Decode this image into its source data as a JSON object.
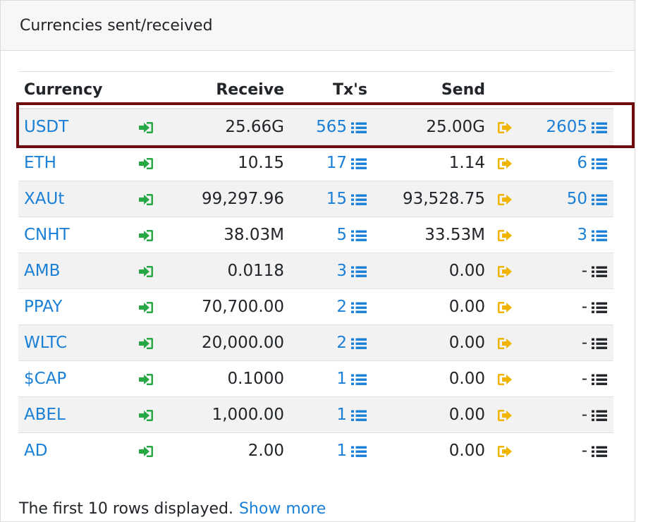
{
  "panel": {
    "title": "Currencies sent/received"
  },
  "table": {
    "headers": {
      "currency": "Currency",
      "receive": "Receive",
      "txs": "Tx's",
      "send": "Send"
    },
    "rows": [
      {
        "currency": "USDT",
        "receive": "25.66G",
        "receive_txs": "565",
        "send": "25.00G",
        "send_txs": "2605"
      },
      {
        "currency": "ETH",
        "receive": "10.15",
        "receive_txs": "17",
        "send": "1.14",
        "send_txs": "6"
      },
      {
        "currency": "XAUt",
        "receive": "99,297.96",
        "receive_txs": "15",
        "send": "93,528.75",
        "send_txs": "50"
      },
      {
        "currency": "CNHT",
        "receive": "38.03M",
        "receive_txs": "5",
        "send": "33.53M",
        "send_txs": "3"
      },
      {
        "currency": "AMB",
        "receive": "0.0118",
        "receive_txs": "3",
        "send": "0.00",
        "send_txs": "-"
      },
      {
        "currency": "PPAY",
        "receive": "70,700.00",
        "receive_txs": "2",
        "send": "0.00",
        "send_txs": "-"
      },
      {
        "currency": "WLTC",
        "receive": "20,000.00",
        "receive_txs": "2",
        "send": "0.00",
        "send_txs": "-"
      },
      {
        "currency": "$CAP",
        "receive": "0.1000",
        "receive_txs": "1",
        "send": "0.00",
        "send_txs": "-"
      },
      {
        "currency": "ABEL",
        "receive": "1,000.00",
        "receive_txs": "1",
        "send": "0.00",
        "send_txs": "-"
      },
      {
        "currency": "AD",
        "receive": "2.00",
        "receive_txs": "1",
        "send": "0.00",
        "send_txs": "-"
      }
    ]
  },
  "footer": {
    "text": "The first 10 rows displayed.",
    "link": "Show more"
  },
  "colors": {
    "link": "#1a7fd6",
    "receive_icon": "#28a745",
    "send_icon": "#f0b400",
    "highlight_border": "#6e0c0c",
    "disabled_list_icon": "#212529"
  },
  "icons": {
    "receive": "sign-in-icon",
    "send": "sign-out-icon",
    "list": "list-icon"
  }
}
